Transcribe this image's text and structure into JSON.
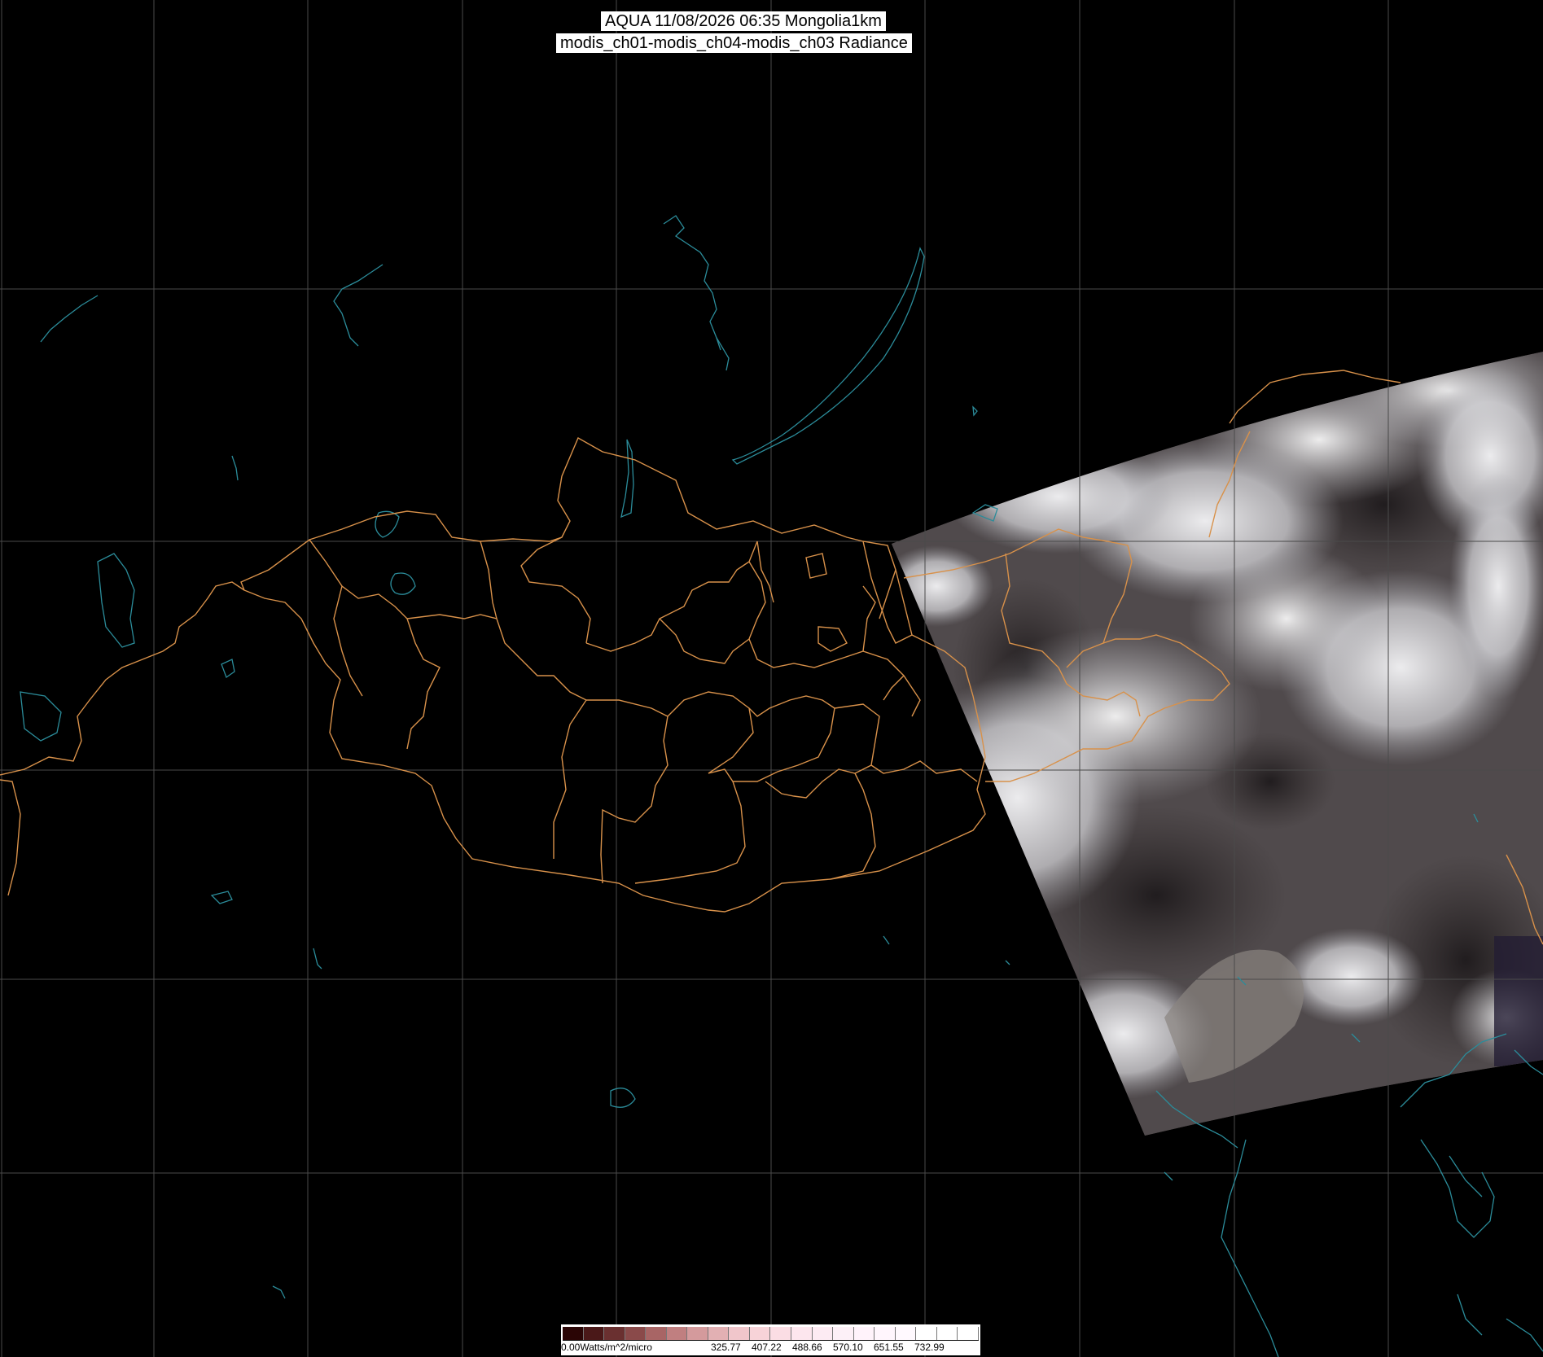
{
  "header": {
    "title_line1": "AQUA 11/08/2026 06:35 Mongolia1km",
    "title_line2": "modis_ch01-modis_ch04-modis_ch03 Radiance"
  },
  "legend": {
    "unit_label": "0.00Watts/m^2/micro",
    "tick_labels": [
      "325.77",
      "407.22",
      "488.66",
      "570.10",
      "651.55",
      "732.99"
    ],
    "colors": [
      "#2a0505",
      "#4a1818",
      "#6a3030",
      "#8a4a4a",
      "#a86565",
      "#c07f80",
      "#d49a9c",
      "#e2b0b3",
      "#f0c6cb",
      "#f7d3d8",
      "#fbdde4",
      "#fde6ee",
      "#fdebf3",
      "#fdf0f7",
      "#fff3fb",
      "#fff6fd",
      "#fff9fe",
      "#ffffff",
      "#ffffff",
      "#ffffff"
    ]
  },
  "map_colors": {
    "background": "#000000",
    "graticule": "#4a4a4a",
    "admin_border": "#d8914a",
    "coastline": "#2b8c9a",
    "cloud": "#e8e8ea",
    "land": "#3a3230"
  }
}
